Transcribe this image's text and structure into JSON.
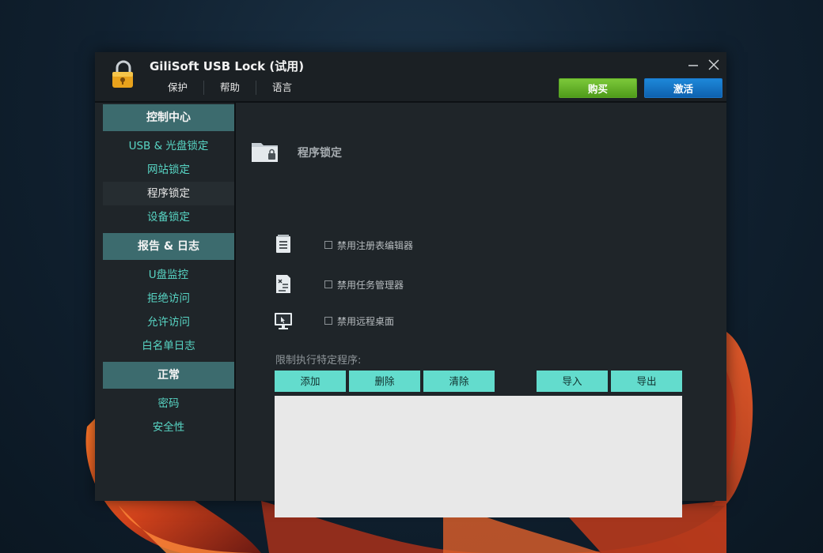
{
  "app": {
    "title": "GiliSoft USB Lock (试用)",
    "menu": [
      "保护",
      "帮助",
      "语言"
    ],
    "buy_label": "购买",
    "activate_label": "激活"
  },
  "sidebar": {
    "sections": [
      {
        "header": "控制中心",
        "items": [
          "USB & 光盘锁定",
          "网站锁定",
          "程序锁定",
          "设备锁定"
        ]
      },
      {
        "header": "报告 & 日志",
        "items": [
          "U盘监控",
          "拒绝访问",
          "允许访问",
          "白名单日志"
        ]
      },
      {
        "header": "正常",
        "items": [
          "密码",
          "安全性"
        ]
      }
    ],
    "active_item": "程序锁定"
  },
  "main": {
    "title": "程序锁定",
    "options": [
      {
        "label": "禁用注册表编辑器",
        "checked": false,
        "icon": "notepad-icon"
      },
      {
        "label": "禁用任务管理器",
        "checked": false,
        "icon": "task-list-icon"
      },
      {
        "label": "禁用远程桌面",
        "checked": false,
        "icon": "remote-desktop-icon"
      }
    ],
    "restrict_label": "限制执行特定程序:",
    "buttons": {
      "add": "添加",
      "delete": "删除",
      "clear": "清除",
      "import": "导入",
      "export": "导出"
    }
  },
  "colors": {
    "accent_teal": "#63dccd",
    "section_header": "#3c6b6e",
    "buy_green": "#5aa526",
    "activate_blue": "#1a74c6"
  }
}
